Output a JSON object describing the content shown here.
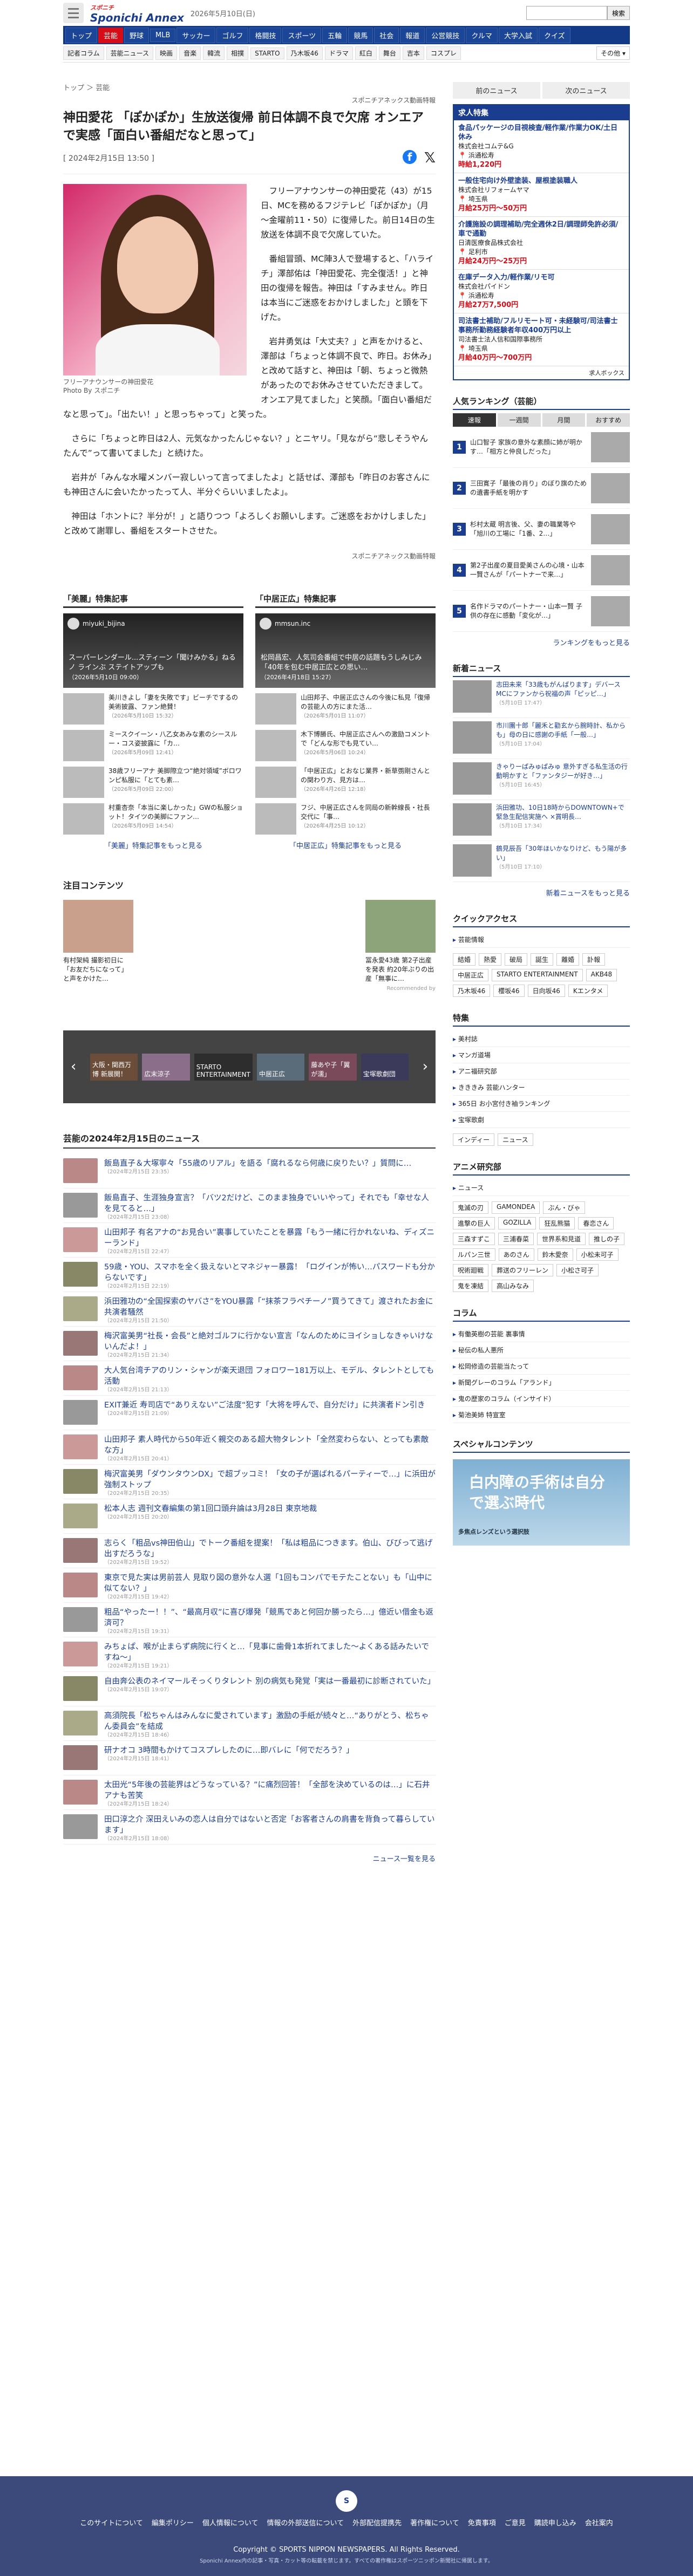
{
  "header": {
    "logo": "Sponichi Annex",
    "logo_sub": "スポニチ",
    "date": "2026年5月10日(日)",
    "search_button": "検索",
    "gnav": [
      "トップ",
      "芸能",
      "野球",
      "MLB",
      "サッカー",
      "ゴルフ",
      "格闘技",
      "スポーツ",
      "五輪",
      "競馬",
      "社会",
      "報道",
      "公営競技",
      "クルマ",
      "大学入試",
      "クイズ"
    ],
    "gnav_active": 1,
    "subnav": [
      "記者コラム",
      "芸能ニュース",
      "映画",
      "音楽",
      "韓流",
      "相撲",
      "STARTO",
      "乃木坂46",
      "ドラマ",
      "紅白",
      "舞台",
      "吉本",
      "コスプレ"
    ],
    "subnav_more": "その他 ▾"
  },
  "article": {
    "breadcrumb": "トップ ＞ 芸能",
    "title": "神田愛花 「ぽかぽか」生放送復帰 前日体調不良で欠席 オンエアで実感「面白い番組だなと思って」",
    "date": "[ 2024年2月15日 13:50 ]",
    "credit_top": "スポニチアネックス動画特報",
    "photo_caption": "フリーアナウンサーの神田愛花",
    "photo_credit": "Photo By スポニチ",
    "paragraphs": [
      "フリーアナウンサーの神田愛花（43）が15日、MCを務めるフジテレビ「ぽかぽか」（月～金曜前11・50）に復帰した。前日14日の生放送を体調不良で欠席していた。",
      "番組冒頭、MC陣3人で登場すると、「ハライチ」澤部佑は「神田愛花、完全復活！」と神田の復帰を報告。神田は「すみません。昨日は本当にご迷惑をおかけしました」と頭を下げた。",
      "岩井勇気は「大丈夫？」と声をかけると、澤部は「ちょっと体調不良で、昨日。お休み」と改めて話すと、神田は「朝、ちょっと微熱があったのでお休みさせていただきまして。オンエア見てました」と笑顔。「面白い番組だなと思って」。「出たい！」と思っちゃって」と笑った。",
      "さらに「ちょっと昨日は2人、元気なかったんじゃない？」とニヤリ。「見ながら“悲しそうやんたんで”って書いてました」と続けた。",
      "岩井が「みんな水曜メンバー寂しいって言ってましたよ」と話せば、澤部も「昨日のお客さんにも神田さんに会いたかったって人、半分ぐらいいましたよ」。",
      "神田は「ホントに？半分が！」と語りつつ「よろしくお願いします。ご迷惑をおかけしました」と改めて謝罪し、番組をスタートさせた。"
    ],
    "credit_bottom": "スポニチアネックス動画特報"
  },
  "specials": {
    "left": {
      "header": "「美麗」特集記事",
      "channel": "miyuki_bijina",
      "card_text": "スーパーレンダール...スティーン「聞けみかる」ねるノ ラインぶ ステイトアップも",
      "card_date": "（2026年5月10日 09:00）",
      "items": [
        {
          "t": "美川きよし「妻を失敗です」ビーチでするの美術披露、ファン絶賛！",
          "d": "（2026年5月10日 15:32）"
        },
        {
          "t": "ミースクイーン・八乙女あみな素のシースルー・コス姿披露に「カ…",
          "d": "（2026年5月09日 12:41）"
        },
        {
          "t": "38歳フリーアナ 美脚際立つ“絶対領域”ボロワンピ私服に「とても素…",
          "d": "（2026年5月09日 22:00）"
        },
        {
          "t": "村重杏奈「本当に楽しかった」GWの私服ショット！タイツの美脚にファン…",
          "d": "（2026年5月09日 14:54）"
        }
      ],
      "more": "「美麗」特集記事をもっと見る"
    },
    "right": {
      "header": "「中居正広」特集記事",
      "channel": "mmsun.inc",
      "card_text": "松岡昌宏、人気司会番組で中居の話題もうしみじみ「40年を包む中居正広との思い…",
      "card_date": "（2026年4月18日 15:27）",
      "items": [
        {
          "t": "山田邦子、中居正広さんの今後に私見「復帰の芸能人の方にまた活…",
          "d": "（2026年5月01日 11:07）"
        },
        {
          "t": "木下博勝氏、中居正広さんへの激励コメントで「どんな形でも見てい…",
          "d": "（2026年5月06日 10:24）"
        },
        {
          "t": "「中居正広」とおなじ業界・新草彅剛さんとの関わり方、見方は…",
          "d": "（2026年4月26日 12:18）"
        },
        {
          "t": "フジ、中居正広さんを同局の新幹線長・社長交代に「事…",
          "d": "（2026年4月25日 10:12）"
        }
      ],
      "more": "「中居正広」特集記事をもっと見る"
    }
  },
  "attention": {
    "header": "注目コンテンツ",
    "items": [
      {
        "t": "有村架純 撮影初日に「お友だちになって」と声をかけた…"
      },
      {
        "t": "冨永愛43歳 第2子出産を発表 約20年ぶりの出産「無事に…"
      }
    ],
    "recommended": "Recommended by"
  },
  "carousel": {
    "slides": [
      "大阪・関西万博 新展開！",
      "広末涼子",
      "STARTO ENTERTAINMENT",
      "中居正広",
      "藤あや子「翼が濡」",
      "宝塚歌劇団"
    ]
  },
  "daynews": {
    "header": "芸能の2024年2月15日のニュース",
    "items": [
      {
        "t": "飯島直子＆大塚寧々「55歳のリアル」を語る「腐れるなら何歳に戻りたい？」質問に…",
        "d": "（2024年2月15日 23:35）"
      },
      {
        "t": "飯島直子、生涯独身宣言？「バツ2だけど、このまま独身でいいやって」それでも「幸せな人を見てると…」",
        "d": "（2024年2月15日 23:08）"
      },
      {
        "t": "山田邦子 有名アナの“お見合い”裏事していたことを暴露「もう一緒に行かれないね、ディズニーランド」",
        "d": "（2024年2月15日 22:47）"
      },
      {
        "t": "59歳・YOU、スマホを全く扱えないとマネジャー暴露！「ログインが怖い…パスワードも分からないです」",
        "d": "（2024年2月15日 22:19）"
      },
      {
        "t": "浜田雅功の“全国探索のヤバさ”をYOU暴露「“抹茶フラペチーノ”買うてきて」渡されたお金に共演者騒然",
        "d": "（2024年2月15日 21:50）"
      },
      {
        "t": "梅沢富美男“社長・会長”と絶対ゴルフに行かない宣言「なんのためにヨイショしなきゃいけないんだよ！」",
        "d": "（2024年2月15日 21:34）"
      },
      {
        "t": "大人気台湾チアのリン・シャンが楽天退団 フォロワー181万以上、モデル、タレントとしても活動",
        "d": "（2024年2月15日 21:13）"
      },
      {
        "t": "EXIT兼近 寿司店で“ありえない”ご法度“犯す「大将を呼んで、自分だけ」に共演者ドン引き",
        "d": "（2024年2月15日 21:09）"
      },
      {
        "t": "山田邦子 素人時代から50年近く親交のある超大物タレント「全然変わらない、とっても素敵な方」",
        "d": "（2024年2月15日 20:41）"
      },
      {
        "t": "梅沢富美男「ダウンタウンDX」で超ブッコミ！「女の子が選ばれるパーティーで…」に浜田が強制ストップ",
        "d": "（2024年2月15日 20:35）"
      },
      {
        "t": "松本人志 週刊文春編集の第1回口頭弁論は3月28日 東京地裁",
        "d": "（2024年2月15日 20:20）"
      },
      {
        "t": "志らく「粗品vs神田伯山」でトーク番組を提案！「私は粗品につきます。伯山、びびって逃げ出すだろうな」",
        "d": "（2024年2月15日 19:52）"
      },
      {
        "t": "東京で見た実は男前芸人 見取り図の意外な人選「1回もコンパでモテたことない」も「山中に似てない？」",
        "d": "（2024年2月15日 19:42）"
      },
      {
        "t": "粗品“やったー！！”、“最高月収”に喜び爆発「競馬であと何回か勝ったら…」億近い借金も返済可？",
        "d": "（2024年2月15日 19:31）"
      },
      {
        "t": "みちょぱ、喉が止まらず病院に行くと…「見事に歯骨1本折れてました～よくある話みたいですね～」",
        "d": "（2024年2月15日 19:21）"
      },
      {
        "t": "自由奔公表のネイマールそっくりタレント 別の病気も発覚「実は一番最初に診断されていた」",
        "d": "（2024年2月15日 19:07）"
      },
      {
        "t": "高須院長「松ちゃんはみんなに愛されています」激励の手紙が続々と…“ありがとう、松ちゃん委員会”を結成",
        "d": "（2024年2月15日 18:46）"
      },
      {
        "t": "研ナオコ 3時間もかけてコスプレしたのに…即バレに「何でだろう？」",
        "d": "（2024年2月15日 18:41）"
      },
      {
        "t": "太田光“5年後の芸能界はどうなっている？”に痛烈回答！「全部を決めているのは…」に石井アナも苦笑",
        "d": "（2024年2月15日 18:24）"
      },
      {
        "t": "田口淳之介 深田えいみの恋人は自分ではないと否定「お客者さんの肩書を背負って暮らしています」",
        "d": "（2024年2月15日 18:08）"
      }
    ],
    "more": "ニュース一覧を見る"
  },
  "sidebar": {
    "tabs": [
      "前のニュース",
      "次のニュース"
    ],
    "jobs_header": "求人特集",
    "jobs": [
      {
        "title": "食品パッケージの目視検査/軽作業/作業力OK/土日休み",
        "co": "株式会社コムテ&G",
        "loc": "浜通松寿",
        "pay": "時給1,220円"
      },
      {
        "title": "一般住宅向け外壁塗装、屋根塗装職人",
        "co": "株式会社リフォームヤマ",
        "loc": "埼玉県",
        "pay": "月給25万円〜50万円"
      },
      {
        "title": "介護施設の調理補助/完全週休2日/調理師免許必須/車で通勤",
        "co": "日清医療食品株式会社",
        "loc": "足利市",
        "pay": "月給24万円〜25万円"
      },
      {
        "title": "在庫データ入力/軽作業/リモ可",
        "co": "株式会社パイドン",
        "loc": "浜通松寿",
        "pay": "月給27万7,500円"
      },
      {
        "title": "司法書士補助/フルリモート可・未経験可/司法書士事務所勤務経験者年収400万円以上",
        "co": "司法書士法人信和国際事務所",
        "loc": "埼玉県",
        "pay": "月給40万円〜700万円"
      }
    ],
    "jobs_footer": "求人ボックス",
    "ranking_header": "人気ランキング（芸能）",
    "ranking_tabs": [
      "速報",
      "一週間",
      "月間",
      "おすすめ"
    ],
    "ranking": [
      {
        "t": "山口智子 家族の意外な素顔に姉が明かす…「相方と仲良しだった」"
      },
      {
        "t": "三田寛子「最後の肖り」のぼり旗のための遺書手紙を明かす"
      },
      {
        "t": "杉村太蔵 明言後、父、妻の職業等や「旭川の工場に「1番、2…」"
      },
      {
        "t": "第2子出産の夏目愛美さんの心境・山本一賢さんが「パートナーで来…」"
      },
      {
        "t": "名作ドラマのパートナー・山本一賢 子供の存在に感動「変化が…」"
      }
    ],
    "ranking_more": "ランキングをもっと見る",
    "latest_header": "新着ニュース",
    "latest": [
      {
        "t": "志田未来「33歳もがんばります」デバースMCにファンから祝福の声「ピッピ…」",
        "d": "（5月10日 17:47）"
      },
      {
        "t": "市川團十郎「麗禾と勸玄から腕時計、私からも」母の日に感謝の手紙「一般…」",
        "d": "（5月10日 17:04）"
      },
      {
        "t": "きゃりーぱみゅぱみゅ 意外すぎる私生活の行動明かすと「ファンタジーが好き…」",
        "d": "（5月10日 16:45）"
      },
      {
        "t": "浜田雅功、10日18時からDOWNTOWN+で緊急生配信実施へ ×賞明長…",
        "d": "（5月10日 17:34）"
      },
      {
        "t": "鶴見辰吾「30年ほいかなりけど、もう陽が多い」",
        "d": "（5月10日 17:10）"
      }
    ],
    "latest_more": "新着ニュースをもっと見る",
    "quick_header": "クイックアクセス",
    "quick_sub": "芸能情報",
    "quick": [
      "結婚",
      "熱愛",
      "破局",
      "誕生",
      "離婚",
      "訃報",
      "中居正広",
      "STARTO ENTERTAINMENT",
      "AKB48",
      "乃木坂46",
      "櫻坂46",
      "日向坂46",
      "Kエンタメ"
    ],
    "special_header": "特集",
    "special": [
      "美村誌",
      "マンガ道場",
      "アニ福研究部",
      "きききみ 芸能ハンター",
      "365日 お小宮付き袖ランキング",
      "宝塚歌劇"
    ],
    "special_extra": [
      "インディー",
      "ニュース"
    ],
    "anime_header": "アニメ研究部",
    "anime_sub": "ニュース",
    "anime_tags": [
      "鬼滅の刃",
      "GAMONDEA",
      "ぶん・びゃ",
      "進撃の巨人",
      "GOZILLA",
      "狂乱熊猫",
      "春恋さん",
      "三森すずこ",
      "三浦春菜",
      "世界系和見道",
      "推しの子",
      "ルパン三世",
      "あのさん",
      "鈴木愛奈",
      "小松未可子",
      "呪術廻戦",
      "葬送のフリーレン",
      "小松さ可子",
      "鬼を凍結",
      "高山みなみ"
    ],
    "column_header": "コラム",
    "columns": [
      "有働英樹の芸能 裏事情",
      "秘伝の私人悪所",
      "松岡修造の芸能当たって",
      "新聞グレーのコラム「アランド」",
      "鬼の歴家のコラム（インサイド）",
      "菊池美姉 特宣室"
    ],
    "sp_header": "スペシャルコンテンツ",
    "banner_text": "白内障の手術は自分で選ぶ時代",
    "banner_small": "多焦点レンズという選択肢"
  },
  "footer": {
    "links": [
      "このサイトについて",
      "編集ポリシー",
      "個人情報について",
      "情報の外部送信について",
      "外部配信提携先",
      "著作権について",
      "免責事項",
      "ご意見",
      "購読申し込み",
      "会社案内"
    ],
    "copy": "Copyright © SPORTS NIPPON NEWSPAPERS. All Rights Reserved.",
    "small": "Sponichi Annex内の記事・写真・カット等の転載を禁じます。すべての著作権はスポーツニッポン新聞社に帰属します。"
  }
}
